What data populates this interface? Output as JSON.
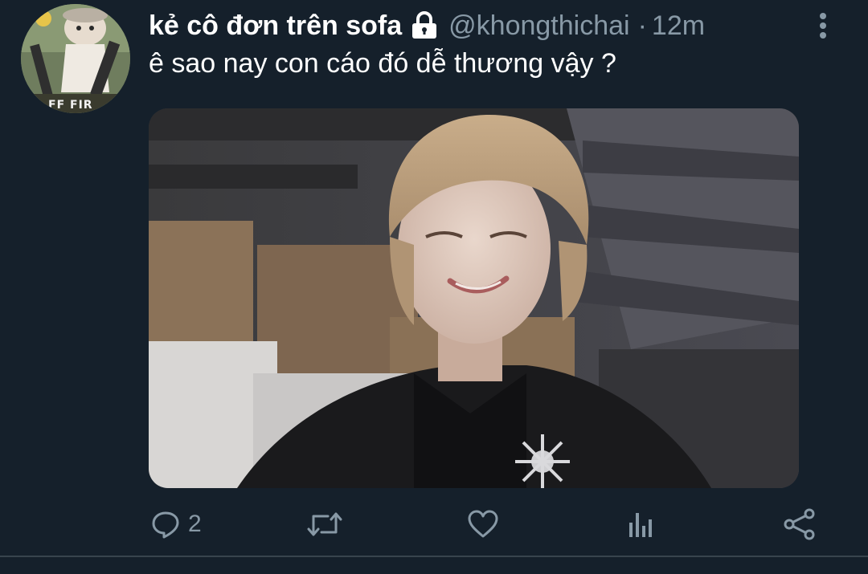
{
  "tweet": {
    "display_name": "kẻ cô đơn trên sofa",
    "handle": "@khongthichai",
    "separator": "·",
    "timestamp": "12m",
    "text": "ê sao nay con cáo đó dễ thương vậy ?",
    "avatar_badge": "FF FIR",
    "icons": {
      "lock": "lock-icon",
      "more": "more-vertical-icon"
    }
  },
  "actions": {
    "reply": {
      "icon": "reply-icon",
      "count": "2"
    },
    "retweet": {
      "icon": "retweet-icon",
      "count": ""
    },
    "like": {
      "icon": "heart-icon",
      "count": ""
    },
    "analytics": {
      "icon": "analytics-icon",
      "count": ""
    },
    "share": {
      "icon": "share-icon",
      "count": ""
    }
  },
  "colors": {
    "background": "#15202b",
    "text_primary": "#ffffff",
    "text_secondary": "#8899a6",
    "divider": "#38444d"
  }
}
